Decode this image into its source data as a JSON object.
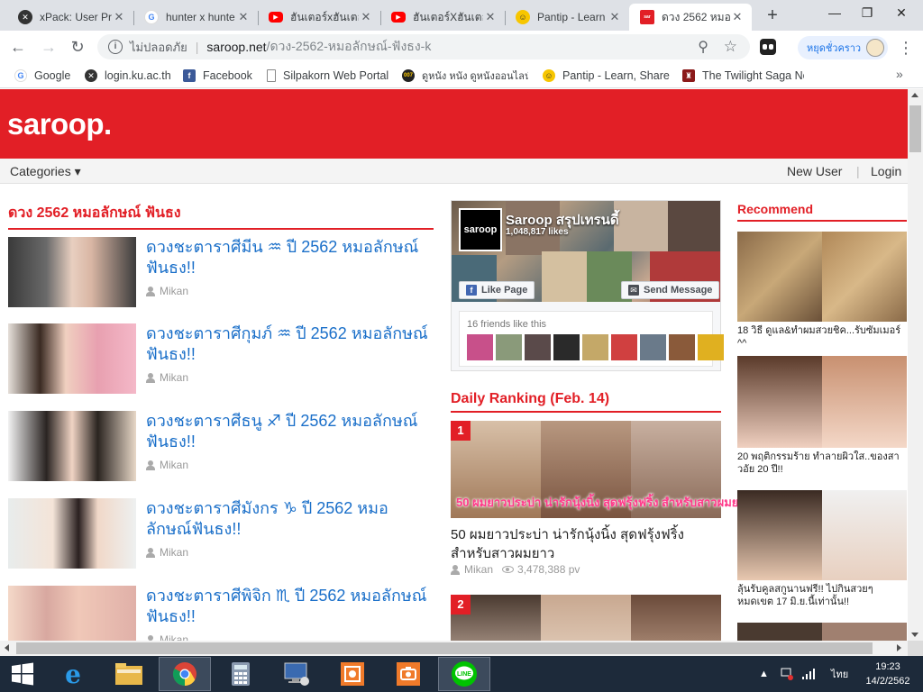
{
  "browser": {
    "tabs": [
      {
        "title": "xPack: User Pr",
        "icon": "xpack-icon"
      },
      {
        "title": "hunter x hunte",
        "icon": "google-icon"
      },
      {
        "title": "ฮันเตอร์xฮันเตอ",
        "icon": "youtube-icon"
      },
      {
        "title": "ฮันเตอร์Xฮันเตอ",
        "icon": "youtube-icon"
      },
      {
        "title": "Pantip - Learn",
        "icon": "pantip-icon"
      },
      {
        "title": "ดวง 2562 หมอ",
        "icon": "saroop-icon",
        "active": true
      }
    ],
    "address": {
      "security": "ไม่ปลอดภัย",
      "host": "saroop.net",
      "path": "/ดวง-2562-หมอลักษณ์-ฟังธง-k"
    },
    "profile_label": "หยุดชั่วคราว",
    "bookmarks": [
      {
        "label": "Google",
        "icon": "google-icon"
      },
      {
        "label": "login.ku.ac.th",
        "icon": "ku-icon"
      },
      {
        "label": "Facebook",
        "icon": "facebook-icon"
      },
      {
        "label": "Silpakorn Web Portal",
        "icon": "page-icon"
      },
      {
        "label": "ดูหนัง หนัง ดูหนังออนไลน์",
        "icon": "movie-icon"
      },
      {
        "label": "Pantip - Learn, Share",
        "icon": "pantip-icon"
      },
      {
        "label": "The Twilight Saga Ne",
        "icon": "twilight-icon"
      }
    ],
    "bookmarks_more": "»"
  },
  "site": {
    "logo": "saroop.",
    "nav": {
      "categories": "Categories",
      "new_user": "New User",
      "separator": "|",
      "login": "Login"
    },
    "main_title": "ดวง 2562 หมอลักษณ์ ฟันธง",
    "articles": [
      {
        "title": "ดวงชะตาราศีมีน ♒ ปี 2562 หมอลักษณ์ฟันธง!!",
        "author": "Mikan"
      },
      {
        "title": "ดวงชะตาราศีกุมภ์ ♒ ปี 2562 หมอลักษณ์ฟันธง!!",
        "author": "Mikan"
      },
      {
        "title": "ดวงชะตาราศีธนู ♐ ปี 2562 หมอลักษณ์ฟันธง!!",
        "author": "Mikan"
      },
      {
        "title": "ดวงชะตาราศีมังกร ♑ ปี 2562 หมอลักษณ์ฟันธง!!",
        "author": "Mikan"
      },
      {
        "title": "ดวงชะตาราศีพิจิก ♏ ปี 2562 หมอลักษณ์ฟันธง!!",
        "author": "Mikan"
      }
    ],
    "facebook": {
      "page_name": "Saroop สรุปเทรนดี้",
      "likes": "1,048,817 likes",
      "logo_text": "saroop",
      "like_button": "Like Page",
      "message_button": "Send Message",
      "friends_text": "16 friends like this"
    },
    "ranking": {
      "title": "Daily Ranking (Feb. 14)",
      "items": [
        {
          "num": "1",
          "caption": "50 ผมยาวประบ่า น่ารักนุ้งนิ้ง สุดฟรุ้งฟริ้ง สำหรับสาวผมยาว",
          "title": "50 ผมยาวประบ่า น่ารักนุ้งนิ้ง สุดฟรุ้งฟริ้ง สำหรับสาวผมยาว",
          "author": "Mikan",
          "views": "3,478,388 pv"
        },
        {
          "num": "2"
        }
      ]
    },
    "recommend": {
      "title": "Recommend",
      "items": [
        {
          "title": "18 วิธี ดูแล&ทำผมสวยชิค...รับซัมเมอร์ ^^"
        },
        {
          "title": "20 พฤติกรรมร้าย ทำลายผิวใส..ของสาวอัย 20 ปี!!"
        },
        {
          "title": "ลุ้นรับคูลสกูนานฟรี!! ไปกินสวยๆ หมดเขต 17 มิ.ย.นี้เท่านั้น!!"
        }
      ]
    }
  },
  "taskbar": {
    "lang": "ไทย",
    "time": "19:23",
    "date": "14/2/2562"
  }
}
